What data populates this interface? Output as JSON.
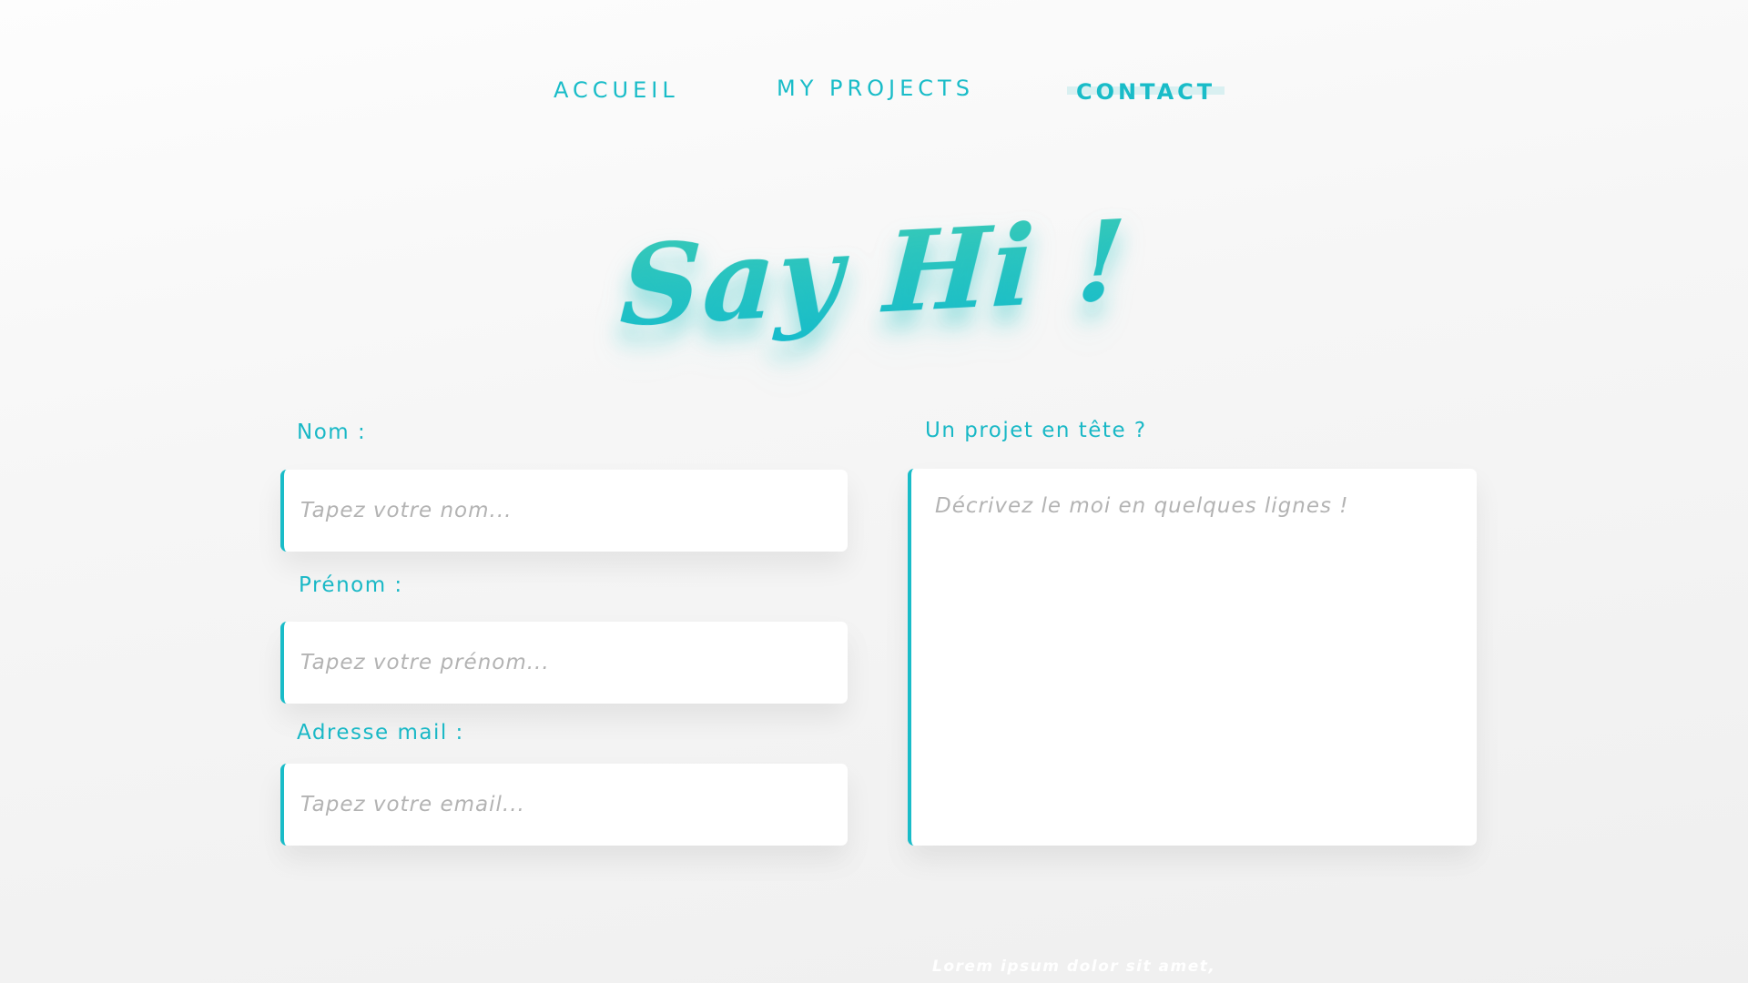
{
  "nav": {
    "items": [
      {
        "label": "ACCUEIL"
      },
      {
        "label": "MY PROJECTS"
      },
      {
        "label": "CONTACT",
        "active": true
      }
    ]
  },
  "title": "Say Hi !",
  "form": {
    "nom": {
      "label": "Nom :",
      "placeholder": "Tapez votre nom...",
      "value": ""
    },
    "prenom": {
      "label": "Prénom :",
      "placeholder": "Tapez votre prénom...",
      "value": ""
    },
    "email": {
      "label": "Adresse mail :",
      "placeholder": "Tapez votre email...",
      "value": ""
    },
    "projet": {
      "label": "Un projet en tête ?",
      "placeholder": "Décrivez le moi en quelques lignes !",
      "value": ""
    }
  },
  "footer": {
    "text": "Lorem ipsum dolor sit amet,"
  },
  "colors": {
    "accent": "#19bcc8",
    "title_gradient_top": "#3ccbb6",
    "title_gradient_bottom": "#16bccd",
    "background": "#f6f6f6",
    "field_background": "#ffffff",
    "placeholder": "#b3b3b3"
  }
}
